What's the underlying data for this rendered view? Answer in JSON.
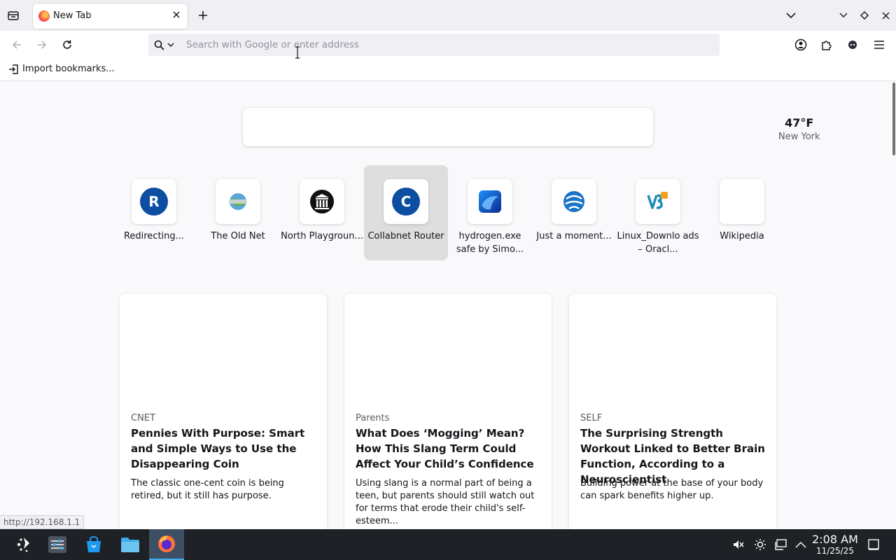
{
  "browser": {
    "tab": {
      "title": "New Tab"
    },
    "urlbar": {
      "placeholder": "Search with Google or enter address"
    },
    "bookmarks": {
      "import_label": "Import bookmarks..."
    }
  },
  "newtab": {
    "weather": {
      "temp": "47°F",
      "city": "New York"
    },
    "top_sites": [
      {
        "label": "Redirecting...",
        "icon": "letter-r-icon",
        "letter": "R"
      },
      {
        "label": "The Old Net",
        "icon": "old-net-icon"
      },
      {
        "label": "North Playgroun...",
        "icon": "museum-icon"
      },
      {
        "label": "Collabnet Router",
        "icon": "letter-c-icon",
        "letter": "C"
      },
      {
        "label": "hydrogen.exe safe by Simo...",
        "icon": "windows11-icon"
      },
      {
        "label": "Just a moment...",
        "icon": "globe-icon"
      },
      {
        "label": "Linux_Downlo ads – Oracl...",
        "icon": "vb-icon"
      },
      {
        "label": "Wikipedia",
        "icon": "blank-icon"
      }
    ],
    "stories": [
      {
        "source": "CNET",
        "headline": "Pennies With Purpose: Smart and Simple Ways to Use the Disappearing Coin",
        "excerpt": "The classic one-cent coin is being retired, but it still has purpose."
      },
      {
        "source": "Parents",
        "headline": "What Does ‘Mogging’ Mean? How This Slang Term Could Affect Your Child’s Confidence",
        "excerpt": "Using slang is a normal part of being a teen, but parents should still watch out for terms that erode their child's self-esteem..."
      },
      {
        "source": "SELF",
        "headline": "The Surprising Strength Workout Linked to Better Brain Function, According to a Neuroscientist",
        "excerpt": "Building power at the base of your body can spark benefits higher up."
      }
    ],
    "status_url": "http://192.168.1.1"
  },
  "taskbar": {
    "time": "2:08 AM",
    "date": "11/25/25"
  },
  "colors": {
    "accent": "#0b4ea2",
    "taskbar": "#1e2125",
    "active_task": "#3d4f64"
  }
}
